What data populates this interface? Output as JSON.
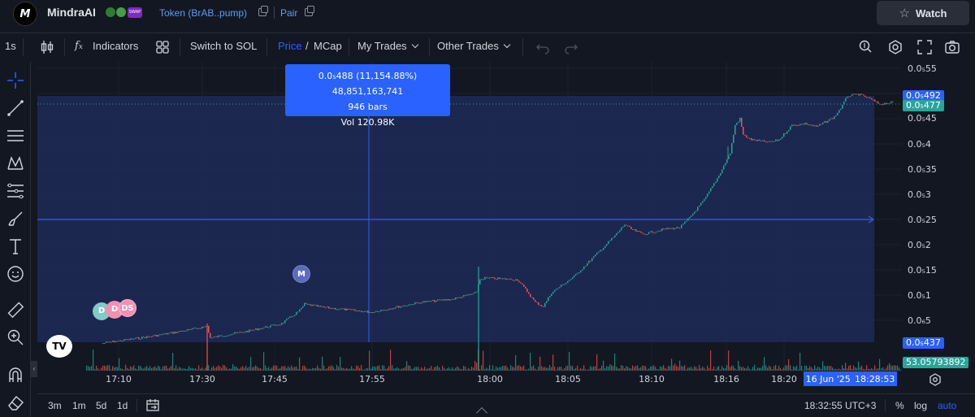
{
  "header": {
    "app_name": "MindraAI",
    "logo_text": "M",
    "token_link": "Token (BrAB..pump)",
    "pair_link": "Pair",
    "watch_label": "Watch",
    "swap_badge": "SWAP"
  },
  "toolbar": {
    "interval": "1s",
    "indicators": "Indicators",
    "switch": "Switch to SOL",
    "price": "Price",
    "slash": "/",
    "mcap": "MCap",
    "my_trades": "My Trades",
    "other_trades": "Other Trades"
  },
  "tooltip": {
    "line1": "0.0₅488 (11,154.88%) 48,851,163,741",
    "line2": "946 bars",
    "line3": "Vol 120.98K"
  },
  "price_axis": {
    "ticks": [
      "0.0₅55",
      "0.0₅45",
      "0.0₅4",
      "0.0₅35",
      "0.0₅3",
      "0.0₅25",
      "0.0₅2",
      "0.0₅15",
      "0.0₅1",
      "0.0₆5"
    ],
    "tag_top_blue": "0.0₅492",
    "tag_top_green": "0.0₅477",
    "tag_low": "0.0₅437",
    "tag_volume": "53.05793892"
  },
  "time_axis": {
    "ticks": [
      "17:10",
      "17:30",
      "17:45",
      "17:55",
      "18:00",
      "18:05",
      "18:10",
      "18:16",
      "18:20"
    ],
    "cursor_date": "16 Jun '25",
    "cursor_time": "18:28:53"
  },
  "markers": {
    "m": "M",
    "ds": "DS",
    "d1": "D",
    "d2": "D"
  },
  "bottom": {
    "ranges": [
      "3m",
      "1m",
      "5d",
      "1d"
    ],
    "clock": "18:32:55 UTC+3",
    "percent": "%",
    "log": "log",
    "auto": "auto"
  },
  "colors": {
    "background": "#131722",
    "up": "#26a69a",
    "down": "#ef5350",
    "accent": "#2962ff",
    "selection": "#1e2a55"
  },
  "icons": [
    "cross-icon",
    "trendline-icon",
    "horizontal-lines-icon",
    "pattern-icon",
    "fib-icon",
    "brush-icon",
    "text-icon",
    "emoji-icon",
    "ruler-icon",
    "zoom-in-icon",
    "magnet-icon",
    "eraser-icon"
  ]
}
